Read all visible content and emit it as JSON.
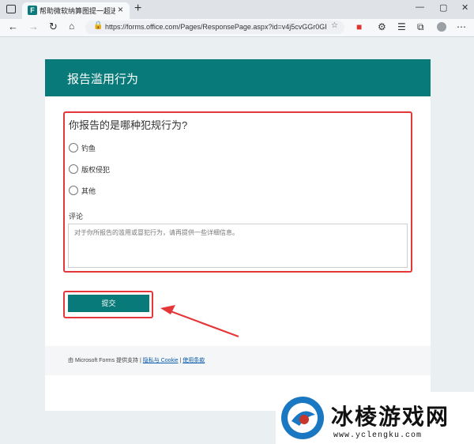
{
  "browser": {
    "tab_title": "帮助微软纳算图提一超进步吧!",
    "tab_close": "×",
    "new_tab": "+",
    "url": "https://forms.office.com/Pages/ResponsePage.aspx?id=v4j5cvGGr0GRqy180...",
    "window_min": "—",
    "window_max": "▢",
    "window_close": "✕"
  },
  "form": {
    "title": "报告滥用行为",
    "question": "你报告的是哪种犯规行为?",
    "options": [
      {
        "label": "钓鱼"
      },
      {
        "label": "版权侵犯"
      },
      {
        "label": "其他"
      }
    ],
    "comment_label": "评论",
    "comment_placeholder": "对于你所报告的滥用或冒犯行为，请再提供一些详细信息。",
    "submit_label": "提交",
    "footer": {
      "prefix": "由 Microsoft Forms 提供支持 | ",
      "privacy": "隐私与 Cookie",
      "sep": " | ",
      "terms": "使用条款"
    }
  },
  "watermark": {
    "main": "冰棱游戏网",
    "url": "www.yclengku.com"
  },
  "colors": {
    "accent": "#077a79",
    "highlight": "#e5373a"
  }
}
